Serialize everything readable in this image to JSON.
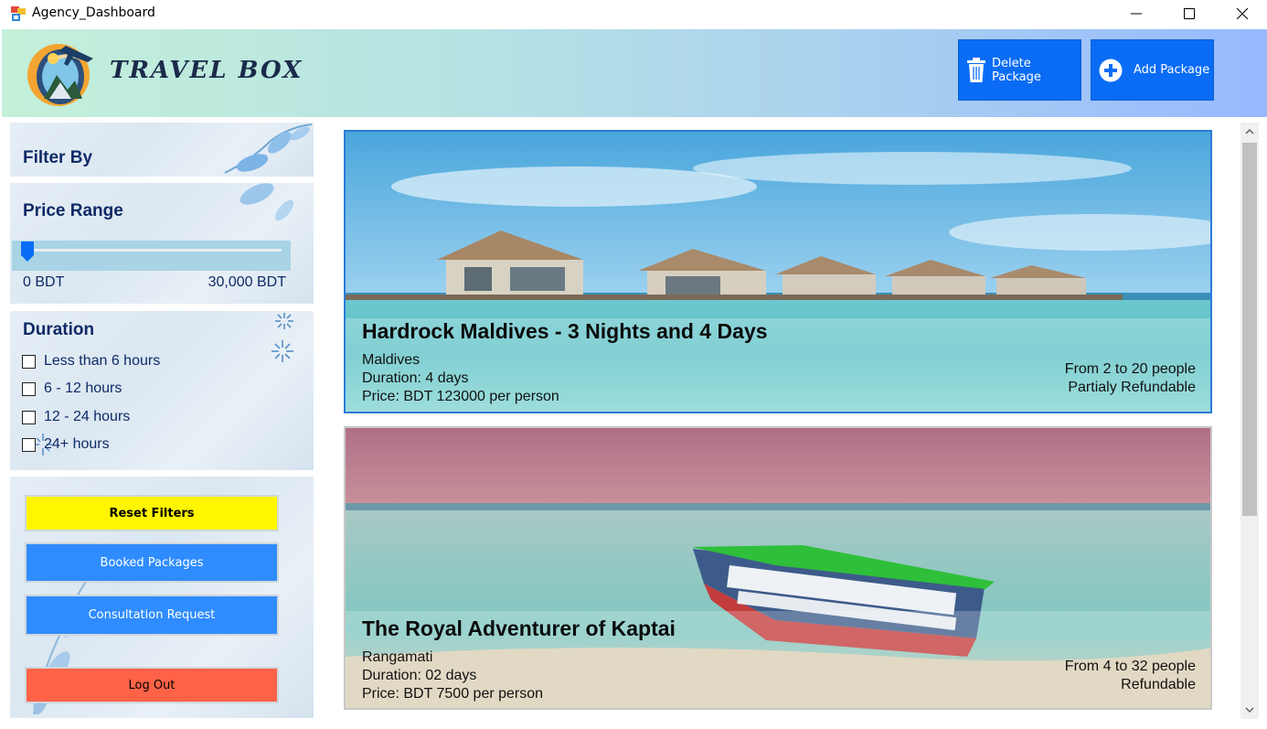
{
  "window": {
    "title": "Agency_Dashboard"
  },
  "header": {
    "brand": "TRAVEL BOX",
    "delete_label": "Delete Package",
    "add_label": "Add Package"
  },
  "filters": {
    "title": "Filter By",
    "price": {
      "title": "Price Range",
      "min_label": "0 BDT",
      "max_label": "30,000 BDT",
      "slider_value": 0
    },
    "duration": {
      "title": "Duration",
      "options": [
        {
          "label": "Less than 6 hours",
          "checked": false
        },
        {
          "label": "6 - 12 hours",
          "checked": false
        },
        {
          "label": "12 - 24 hours",
          "checked": false
        },
        {
          "label": "24+ hours",
          "checked": false
        }
      ]
    }
  },
  "actions": {
    "reset": "Reset Filters",
    "booked": "Booked Packages",
    "consult": "Consultation Request",
    "logout": "Log Out"
  },
  "packages": [
    {
      "title": "Hardrock Maldives - 3 Nights and 4 Days",
      "location": "Maldives",
      "duration": "Duration: 4 days",
      "price": "Price: BDT 123000 per person",
      "people": "From 2 to 20 people",
      "refund": "Partialy Refundable"
    },
    {
      "title": "The Royal Adventurer of Kaptai",
      "location": " Rangamati",
      "duration": "Duration: 02 days",
      "price": "Price: BDT 7500 per person",
      "people": "From 4 to 32 people",
      "refund": "Refundable"
    }
  ],
  "colors": {
    "accent_blue": "#0a6cf5",
    "button_blue": "#2f8cff",
    "reset_yellow": "#fff600",
    "logout_red": "#ff6347",
    "heading_navy": "#0e2a66"
  },
  "icons": {
    "app": "app-window-icon",
    "delete": "trash-icon",
    "add": "plus-circle-icon"
  }
}
